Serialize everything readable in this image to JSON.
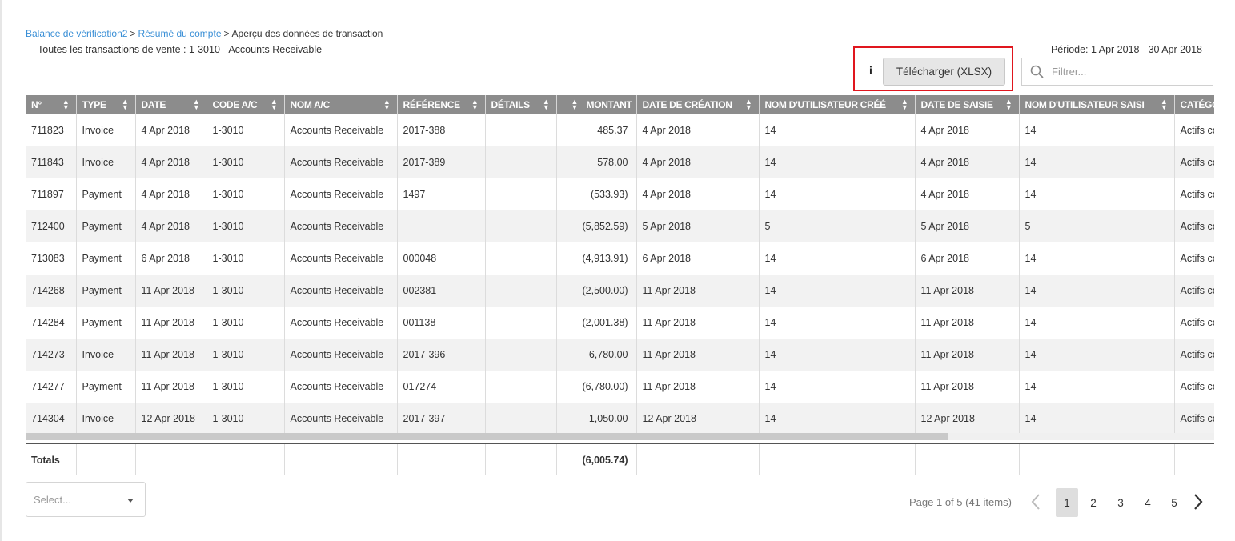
{
  "breadcrumb": {
    "item1": "Balance de vérification2",
    "item2": "Résumé du compte",
    "current": "Aperçu des données de transaction",
    "sep": ">"
  },
  "subtitle": "Toutes les transactions de vente : 1-3010 - Accounts Receivable",
  "period": "Période: 1 Apr 2018 - 30 Apr 2018",
  "toolbar": {
    "info_label": "i",
    "download_label": "Télécharger (XLSX)",
    "filter_placeholder": "Filtrer..."
  },
  "table": {
    "columns": [
      "N°",
      "TYPE",
      "DATE",
      "CODE A/C",
      "NOM A/C",
      "RÉFÉRENCE",
      "DÉTAILS",
      "MONTANT",
      "DATE DE CRÉATION",
      "NOM D'UTILISATEUR CRÉÉ",
      "DATE DE SAISIE",
      "NOM D'UTILISATEUR SAISI",
      "CATÉGORIE"
    ],
    "rows": [
      [
        "711823",
        "Invoice",
        "4 Apr 2018",
        "1-3010",
        "Accounts Receivable",
        "2017-388",
        "",
        "485.37",
        "4 Apr 2018",
        "14",
        "4 Apr 2018",
        "14",
        "Actifs courants"
      ],
      [
        "711843",
        "Invoice",
        "4 Apr 2018",
        "1-3010",
        "Accounts Receivable",
        "2017-389",
        "",
        "578.00",
        "4 Apr 2018",
        "14",
        "4 Apr 2018",
        "14",
        "Actifs courants"
      ],
      [
        "711897",
        "Payment",
        "4 Apr 2018",
        "1-3010",
        "Accounts Receivable",
        "1497",
        "",
        "(533.93)",
        "4 Apr 2018",
        "14",
        "4 Apr 2018",
        "14",
        "Actifs courants"
      ],
      [
        "712400",
        "Payment",
        "4 Apr 2018",
        "1-3010",
        "Accounts Receivable",
        "",
        "",
        "(5,852.59)",
        "5 Apr 2018",
        "5",
        "5 Apr 2018",
        "5",
        "Actifs courants"
      ],
      [
        "713083",
        "Payment",
        "6 Apr 2018",
        "1-3010",
        "Accounts Receivable",
        "000048",
        "",
        "(4,913.91)",
        "6 Apr 2018",
        "14",
        "6 Apr 2018",
        "14",
        "Actifs courants"
      ],
      [
        "714268",
        "Payment",
        "11 Apr 2018",
        "1-3010",
        "Accounts Receivable",
        "002381",
        "",
        "(2,500.00)",
        "11 Apr 2018",
        "14",
        "11 Apr 2018",
        "14",
        "Actifs courants"
      ],
      [
        "714284",
        "Payment",
        "11 Apr 2018",
        "1-3010",
        "Accounts Receivable",
        "001138",
        "",
        "(2,001.38)",
        "11 Apr 2018",
        "14",
        "11 Apr 2018",
        "14",
        "Actifs courants"
      ],
      [
        "714273",
        "Invoice",
        "11 Apr 2018",
        "1-3010",
        "Accounts Receivable",
        "2017-396",
        "",
        "6,780.00",
        "11 Apr 2018",
        "14",
        "11 Apr 2018",
        "14",
        "Actifs courants"
      ],
      [
        "714277",
        "Payment",
        "11 Apr 2018",
        "1-3010",
        "Accounts Receivable",
        "017274",
        "",
        "(6,780.00)",
        "11 Apr 2018",
        "14",
        "11 Apr 2018",
        "14",
        "Actifs courants"
      ],
      [
        "714304",
        "Invoice",
        "12 Apr 2018",
        "1-3010",
        "Accounts Receivable",
        "2017-397",
        "",
        "1,050.00",
        "12 Apr 2018",
        "14",
        "12 Apr 2018",
        "14",
        "Actifs courants"
      ]
    ],
    "totals_label": "Totals",
    "totals_amount": "(6,005.74)"
  },
  "page_size_select": {
    "placeholder": "Select..."
  },
  "pagination": {
    "info": "Page 1 of 5 (41 items)",
    "pages": [
      "1",
      "2",
      "3",
      "4",
      "5"
    ],
    "current": "1"
  }
}
